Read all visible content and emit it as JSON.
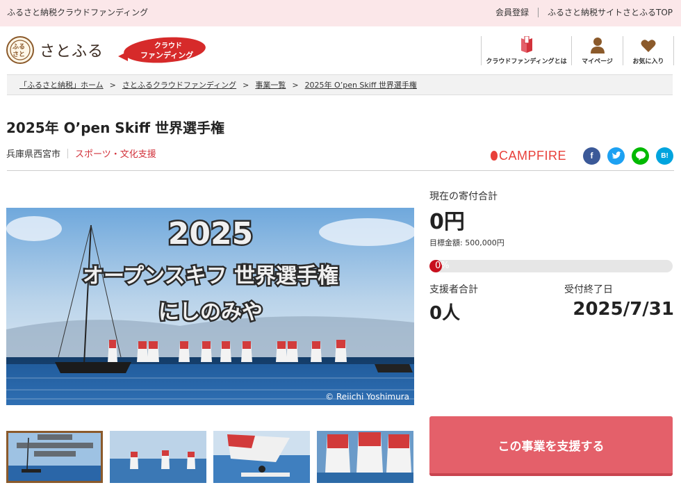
{
  "topbar": {
    "tagline": "ふるさと納税クラウドファンディング",
    "links": [
      "会員登録",
      "ふるさと納税サイトさとふるTOP"
    ]
  },
  "header": {
    "logo_text": "さとふる",
    "logo_mark_text": "ふるさと",
    "badge_line1": "クラウド",
    "badge_line2": "ファンディング",
    "nav": [
      {
        "label": "クラウドファンディングとは",
        "icon": "book-icon"
      },
      {
        "label": "マイページ",
        "icon": "user-icon"
      },
      {
        "label": "お気に入り",
        "icon": "heart-icon"
      }
    ]
  },
  "breadcrumb": [
    "「ふるさと納税」ホーム",
    "さとふるクラウドファンディング",
    "事業一覧",
    "2025年 O’pen Skiff 世界選手権"
  ],
  "project": {
    "title": "2025年 O’pen Skiff 世界選手権",
    "location": "兵庫県西宮市",
    "category": "スポーツ・文化支援"
  },
  "share": {
    "campfire": "CAMPFIRE",
    "buttons": [
      {
        "name": "facebook",
        "glyph": "f",
        "color": "#3b5998"
      },
      {
        "name": "twitter",
        "glyph": "t",
        "color": "#1da1f2"
      },
      {
        "name": "line",
        "glyph": "L",
        "color": "#00b900"
      },
      {
        "name": "hatena",
        "glyph": "B!",
        "color": "#00a4de"
      }
    ]
  },
  "hero": {
    "line1": "2025",
    "line2": "オープンスキフ 世界選手権",
    "line3": "にしのみや",
    "credit": "© Reiichi Yoshimura"
  },
  "funding": {
    "raised_label": "現在の寄付合計",
    "raised_value": "0円",
    "goal_text": "目標金額: 500,000円",
    "progress_text": "0%",
    "progress_fraction": 0,
    "supporters_label": "支援者合計",
    "supporters_value": "0人",
    "deadline_label": "受付終了日",
    "deadline_value": "2025/7/31"
  },
  "cta": {
    "support_label": "この事業を支援する"
  },
  "colors": {
    "accent": "#d2323b",
    "cta": "#e4606a",
    "brand_brown": "#8b5a2b"
  }
}
